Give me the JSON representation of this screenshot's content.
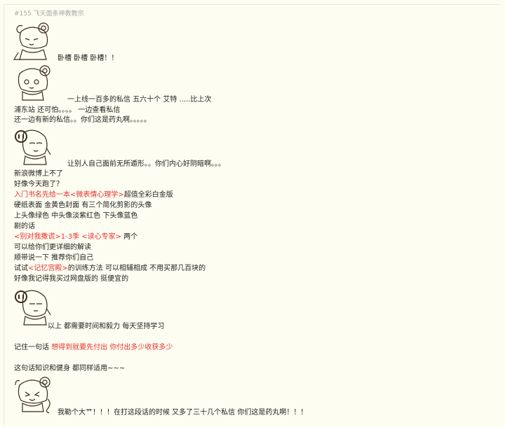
{
  "header": "#155 飞天面条神教教宗",
  "colors": {
    "accent_red": "#e8312f",
    "background": "#fdfdf1",
    "header_gray": "#a9a9a9"
  },
  "lines": {
    "l1": "卧槽 卧槽 卧槽！！",
    "l2": "一上线一百多的私信  五六十个 艾特 .....比上次",
    "l3": "浦东站 还可怕。。。。 一边查看私信",
    "l4": "还一边有新的私信。。你们这是药丸啊。。。。。",
    "l5": "让别人自己面前无所遁形。。你们内心好阴暗啊。。。",
    "l6": "新浪微博上不了",
    "l7": "好像今天跑了？",
    "l8_red": "入门书名先给一本<微表情心理学>",
    "l8_rest": "超值全彩白金版",
    "l9": "硬纸表面 金黄色封面 有三个简化剪影的头像",
    "l10": "上头像绿色 中头像淡紫红色 下头像蓝色",
    "l11": "剧的话",
    "l12_red": "<别对我撒谎>1-3季   <读心专家>",
    "l12_rest": "  两个",
    "l13": "可以给你们更详细的解读",
    "l14": "顺带说一下  推荐你们自己",
    "l15_a": "试试",
    "l15_red": "<记忆宫殿>",
    "l15_b": "的训练方法  可以相辅相成  不用买那几百块的",
    "l16": "好像我记得我买过网盘版的 挺便宜的",
    "l17": "以上 都需要时间和毅力 每天坚持学习",
    "l18_a": "记住一句话  ",
    "l18_red": "想得到就要先付出  你付出多少收获多少",
    "l19": "这句话知识和健身 都同样适用~~~",
    "l20": "我勒个大艹！！！在打这段话的时候 又多了三十几个私信 你们这是药丸啊！！！"
  },
  "avatars": [
    "anime-girl-emoticon",
    "anime-girl-emoticon",
    "anime-girl-emoticon",
    "anime-girl-emoticon",
    "anime-girl-emoticon"
  ]
}
